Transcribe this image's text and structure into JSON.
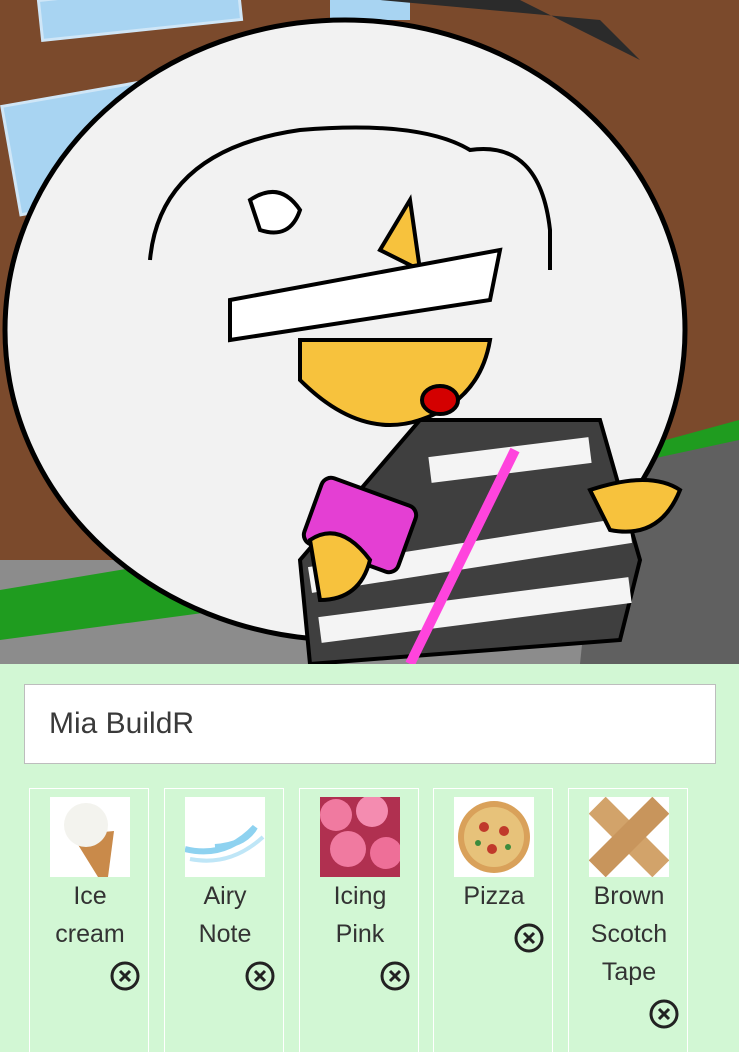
{
  "artwork": {
    "description_icon": "character-drawing"
  },
  "name_input": {
    "value": "Mia BuildR"
  },
  "items": [
    {
      "label": "Ice\ncream",
      "thumb_icon": "ice-cream-icon"
    },
    {
      "label": "Airy\nNote",
      "thumb_icon": "air-swirl-icon"
    },
    {
      "label": "Icing\nPink",
      "thumb_icon": "pink-icing-icon"
    },
    {
      "label": "Pizza",
      "thumb_icon": "pizza-icon"
    },
    {
      "label": "Brown\nScotch\nTape",
      "thumb_icon": "tape-icon"
    }
  ],
  "colors": {
    "panel_bg": "#d2f7d4",
    "card_border": "#ffffff"
  }
}
